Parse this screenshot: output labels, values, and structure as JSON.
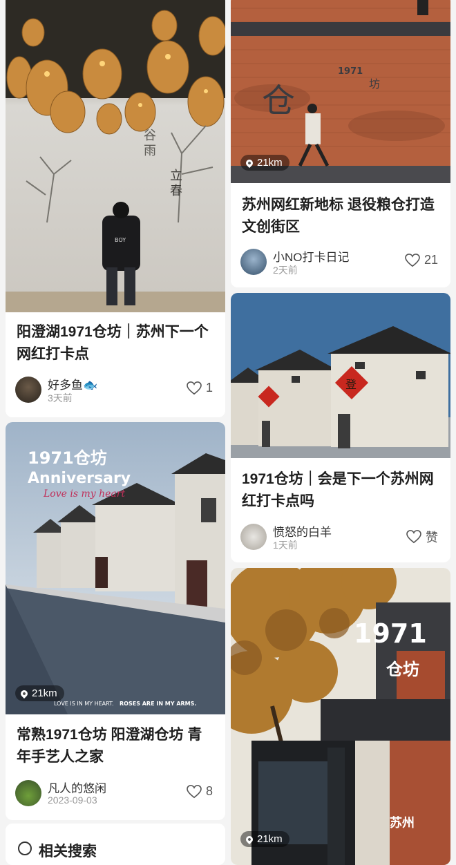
{
  "feed": {
    "cards": [
      {
        "title": "阳澄湖1971仓坊｜苏州下一个网红打卡点",
        "author": "好多鱼🐟",
        "date": "3天前",
        "likes": "1",
        "image_text": [
          "谷雨",
          "立春",
          "BOY"
        ]
      },
      {
        "title": "常熟1971仓坊 阳澄湖仓坊 青年手艺人之家",
        "author": "凡人的悠闲",
        "date": "2023-09-03",
        "likes": "8",
        "distance": "21km",
        "image_text": [
          "1971仓坊",
          "Anniversary",
          "Love is my heart",
          "LOVE IS IN MY HEART.",
          "ROSES ARE IN MY ARMS."
        ]
      },
      {
        "title": "苏州网红新地标 退役粮仓打造文创街区",
        "author": "小NO打卡日记",
        "date": "2天前",
        "likes": "21",
        "distance": "21km",
        "image_text": [
          "1971",
          "仓",
          "坊"
        ]
      },
      {
        "title": "1971仓坊｜会是下一个苏州网红打卡点吗",
        "author": "愤怒的白羊",
        "date": "1天前",
        "likes": "赞",
        "image_text": [
          "登"
        ]
      },
      {
        "distance": "21km",
        "image_text": [
          "1971",
          "仓坊",
          "苏州"
        ]
      }
    ],
    "related_search": "相关搜索"
  },
  "colors": {
    "background": "#f4f4f4",
    "card": "#ffffff",
    "title": "#1e1e1e",
    "meta_gray": "#999999",
    "brick": "#b4603e",
    "sky_blue": "#3f6f9f"
  }
}
